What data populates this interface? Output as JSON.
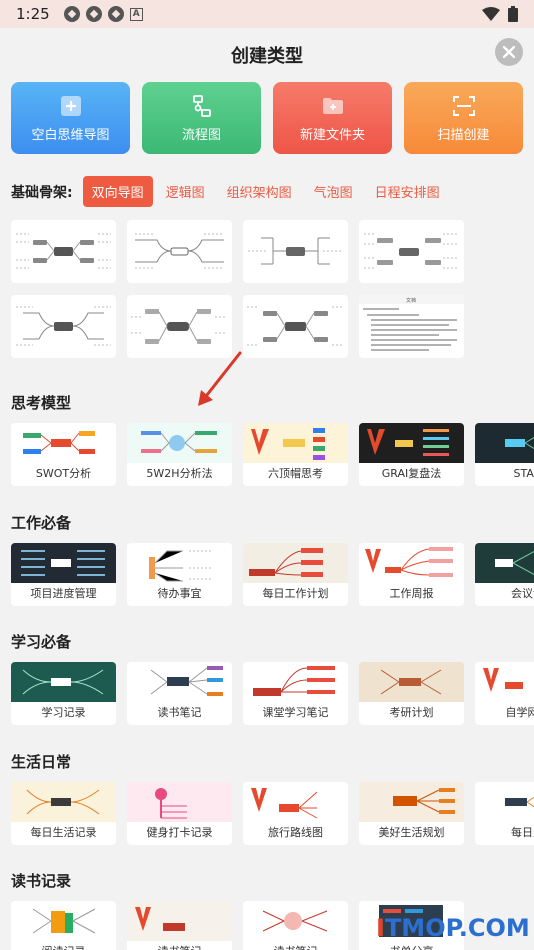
{
  "status_bar": {
    "time": "1:25"
  },
  "dialog": {
    "title": "创建类型"
  },
  "quick_actions": [
    {
      "label": "空白思维导图",
      "icon": "plus-icon"
    },
    {
      "label": "流程图",
      "icon": "flowchart-icon"
    },
    {
      "label": "新建文件夹",
      "icon": "folder-icon"
    },
    {
      "label": "扫描创建",
      "icon": "scan-icon"
    }
  ],
  "basic": {
    "label": "基础骨架:",
    "tabs": [
      "双向导图",
      "逻辑图",
      "组织架构图",
      "气泡图",
      "日程安排图"
    ],
    "active_tab": 0,
    "doc_thumb_title": "文档"
  },
  "sections": [
    {
      "title": "思考模型",
      "items": [
        "SWOT分析",
        "5W2H分析法",
        "六顶帽思考",
        "GRAI复盘法",
        "STAR"
      ]
    },
    {
      "title": "工作必备",
      "items": [
        "项目进度管理",
        "待办事宜",
        "每日工作计划",
        "工作周报",
        "会议记"
      ]
    },
    {
      "title": "学习必备",
      "items": [
        "学习记录",
        "读书笔记",
        "课堂学习笔记",
        "考研计划",
        "自学网课"
      ]
    },
    {
      "title": "生活日常",
      "items": [
        "每日生活记录",
        "健身打卡记录",
        "旅行路线图",
        "美好生活规划",
        "每日生"
      ]
    },
    {
      "title": "读书记录",
      "items": [
        "阅读记录",
        "读书笔记",
        "读书笔记",
        "书单分享",
        ""
      ]
    }
  ],
  "watermark": {
    "prefix": "I",
    "text": "TMOP.COM"
  }
}
